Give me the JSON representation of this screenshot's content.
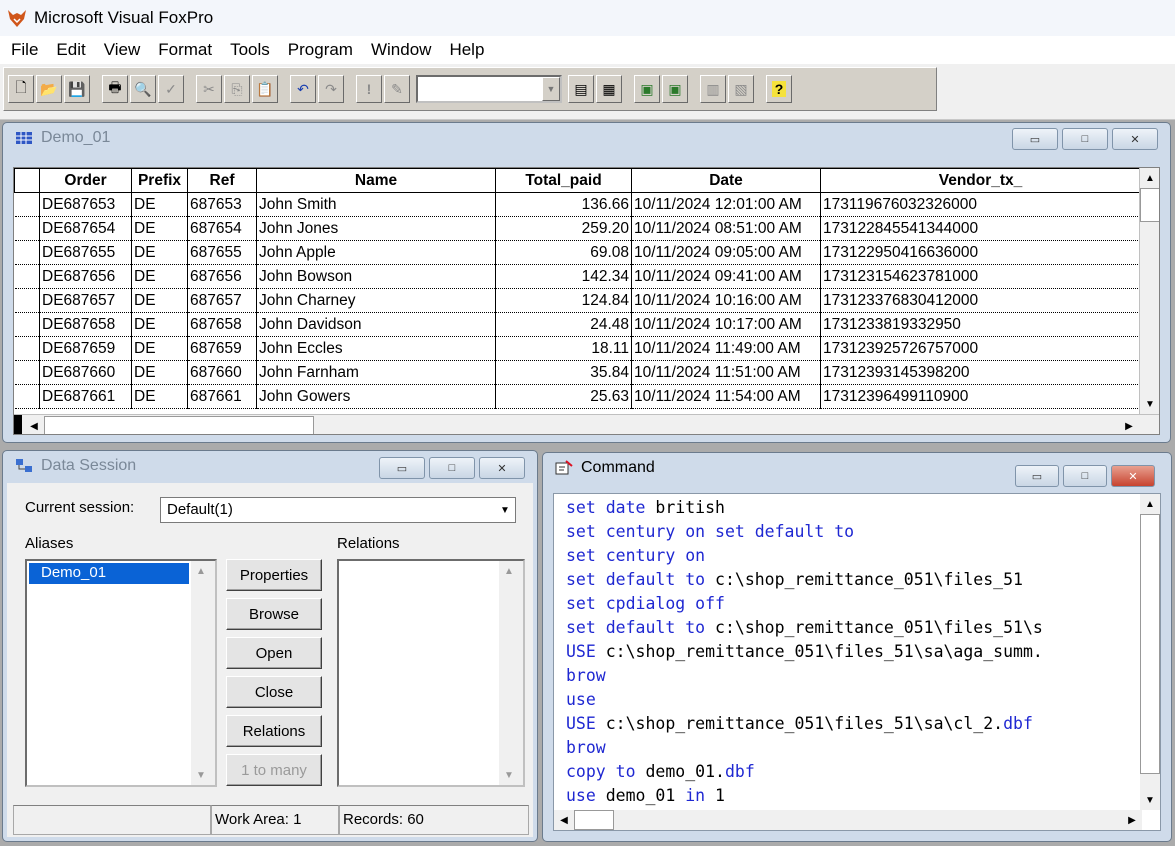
{
  "app": {
    "title": "Microsoft Visual FoxPro"
  },
  "menu": [
    "File",
    "Edit",
    "View",
    "Format",
    "Tools",
    "Program",
    "Window",
    "Help"
  ],
  "toolbar": {
    "buttons": [
      "new-icon",
      "open-icon",
      "save-icon",
      "print-icon",
      "print-preview-icon",
      "spelling-icon",
      "cut-icon",
      "copy-icon",
      "paste-icon",
      "undo-icon",
      "redo-icon",
      "run-icon",
      "modify-form-icon",
      "database-combo",
      "command-window-icon",
      "view-window-icon",
      "form-wizard-icon",
      "report-wizard-icon",
      "autoform-icon",
      "autoreport-icon",
      "help-icon"
    ],
    "database_value": ""
  },
  "browse": {
    "title": "Demo_01",
    "columns": [
      "Order",
      "Prefix",
      "Ref",
      "Name",
      "Total_paid",
      "Date",
      "Vendor_tx_"
    ],
    "rows": [
      [
        "DE687653",
        "DE",
        "687653",
        "John Smith",
        "136.66",
        "10/11/2024 12:01:00 AM",
        "173119676032326000"
      ],
      [
        "DE687654",
        "DE",
        "687654",
        "John Jones",
        "259.20",
        "10/11/2024 08:51:00 AM",
        "173122845541344000"
      ],
      [
        "DE687655",
        "DE",
        "687655",
        "John Apple",
        "69.08",
        "10/11/2024 09:05:00 AM",
        "173122950416636000"
      ],
      [
        "DE687656",
        "DE",
        "687656",
        "John Bowson",
        "142.34",
        "10/11/2024 09:41:00 AM",
        "173123154623781000"
      ],
      [
        "DE687657",
        "DE",
        "687657",
        "John Charney",
        "124.84",
        "10/11/2024 10:16:00 AM",
        "173123376830412000"
      ],
      [
        "DE687658",
        "DE",
        "687658",
        "John Davidson",
        "24.48",
        "10/11/2024 10:17:00 AM",
        "173123381933295O"
      ],
      [
        "DE687659",
        "DE",
        "687659",
        "John Eccles",
        "18.11",
        "10/11/2024 11:49:00 AM",
        "173123925726757000"
      ],
      [
        "DE687660",
        "DE",
        "687660",
        "John Farnham",
        "35.84",
        "10/11/2024 11:51:00 AM",
        "173123931453982OO"
      ],
      [
        "DE687661",
        "DE",
        "687661",
        "John Gowers",
        "25.63",
        "10/11/2024 11:54:00 AM",
        "173123964991109OO"
      ]
    ]
  },
  "data_session": {
    "title": "Data Session",
    "current_session_label": "Current session:",
    "current_session_value": "Default(1)",
    "aliases_label": "Aliases",
    "relations_label": "Relations",
    "alias_selected": "Demo_01",
    "buttons": {
      "properties": "Properties",
      "browse": "Browse",
      "open": "Open",
      "close": "Close",
      "relations": "Relations",
      "one_to_many": "1 to many"
    },
    "status": {
      "left": "",
      "work_area": "Work Area: 1",
      "records": "Records: 60"
    }
  },
  "command": {
    "title": "Command",
    "lines": [
      [
        [
          "k",
          "set date "
        ],
        [
          "t",
          "british"
        ]
      ],
      [
        [
          "k",
          "set century on set default to"
        ]
      ],
      [
        [
          "k",
          "set century on"
        ]
      ],
      [
        [
          "k",
          "set default to "
        ],
        [
          "t",
          "c:\\shop_remittance_051\\files_51"
        ]
      ],
      [
        [
          "k",
          "set cpdialog off"
        ]
      ],
      [
        [
          "k",
          "set default to "
        ],
        [
          "t",
          "c:\\shop_remittance_051\\files_51\\s"
        ]
      ],
      [
        [
          "k",
          "USE "
        ],
        [
          "t",
          "c:\\shop_remittance_051\\files_51\\sa\\aga_summ."
        ]
      ],
      [
        [
          "k",
          "brow"
        ]
      ],
      [
        [
          "k",
          "use"
        ]
      ],
      [
        [
          "k",
          "USE "
        ],
        [
          "t",
          "c:\\shop_remittance_051\\files_51\\sa\\cl_2."
        ],
        [
          "k",
          "dbf"
        ]
      ],
      [
        [
          "k",
          "brow"
        ]
      ],
      [
        [
          "k",
          "copy to "
        ],
        [
          "t",
          "demo_01."
        ],
        [
          "k",
          "dbf"
        ]
      ],
      [
        [
          "k",
          "use "
        ],
        [
          "t",
          "demo_01 "
        ],
        [
          "k",
          "in "
        ],
        [
          "t",
          "1"
        ]
      ]
    ]
  }
}
